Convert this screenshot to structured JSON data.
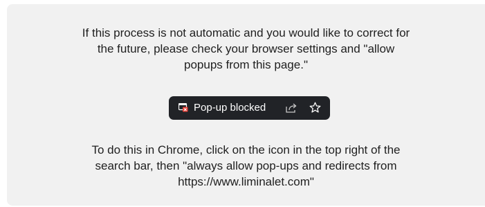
{
  "instructions": {
    "top_lines": [
      "If this process is not automatic and you would like to correct for",
      "the future, please check your browser settings and \"allow",
      "popups from this page.\""
    ],
    "bottom_lines": [
      "To do this in Chrome, click on the icon in the top right of the",
      "search bar, then \"always allow pop-ups and redirects from",
      "https://www.liminalet.com\""
    ]
  },
  "popup_chip": {
    "label": "Pop-up blocked",
    "icons": [
      "popup-blocked-icon",
      "share-icon",
      "bookmark-star-icon"
    ],
    "background_color": "#212327",
    "alert_color": "#e8453c"
  }
}
